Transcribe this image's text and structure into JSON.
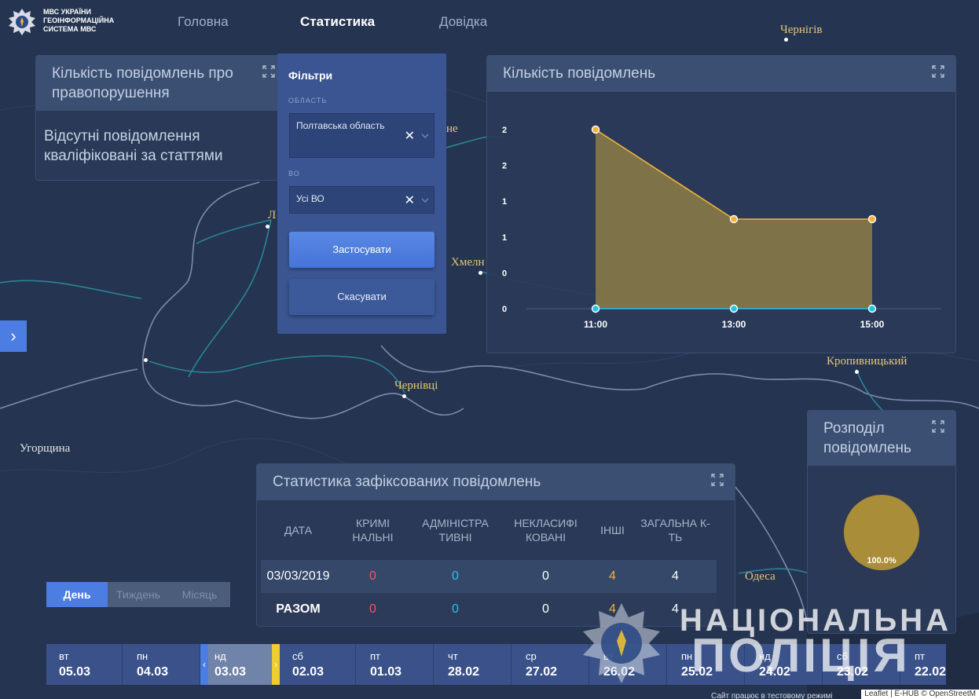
{
  "header": {
    "brand_lines": [
      "МВС УКРАЇНИ",
      "ГЕОІНФОРМАЦІЙНА",
      "СИСТЕМА МВС"
    ],
    "nav": [
      {
        "label": "Головна",
        "active": false
      },
      {
        "label": "Статистика",
        "active": true
      },
      {
        "label": "Довідка",
        "active": false
      }
    ]
  },
  "map_labels": {
    "chernihiv": "Чернігів",
    "khmelnytskyi": "Хмелн",
    "chernivtsi": "Чернівці",
    "kropyvnytskyi": "Кропивницький",
    "hungary": "Угорщина",
    "odesa": "Одеса",
    "rivne_partial": "не",
    "lutsk_partial": "Л"
  },
  "offenses_panel": {
    "title": "Кількість повідомлень про правопорушення",
    "empty_text": "Відсутні повідомлення кваліфіковані за статтями"
  },
  "filters": {
    "title": "Фільтри",
    "region_label": "ОБЛАСТЬ",
    "region_value": "Полтавська область",
    "vo_label": "ВО",
    "vo_value": "Усі ВО",
    "clear_symbol": "✕",
    "apply_label": "Застосувати",
    "cancel_label": "Скасувати"
  },
  "chart_panel": {
    "title": "Кількість повідомлень"
  },
  "chart_data": {
    "type": "area",
    "categories": [
      "11:00",
      "13:00",
      "15:00"
    ],
    "y_tick_labels": [
      "0",
      "0",
      "1",
      "1",
      "2",
      "2"
    ],
    "ylim": [
      0,
      2
    ],
    "series": [
      {
        "values": [
          2,
          1,
          1
        ],
        "color": "#f1b23b"
      },
      {
        "values": [
          0,
          0,
          0
        ],
        "color": "#27c3e6"
      }
    ],
    "grid": false
  },
  "distribution_panel": {
    "title": "Розподіл повідомлень",
    "pie": {
      "slices": [
        {
          "value": 100,
          "label": "100.0%",
          "color": "#a98d39"
        }
      ]
    }
  },
  "stats_panel": {
    "title": "Статистика зафіксованих повідомлень",
    "columns": [
      "ДАТА",
      "КРИМІ НАЛЬНІ",
      "АДМІНІСТРА ТИВНІ",
      "НЕКЛАСИФІ КОВАНІ",
      "ІНШІ",
      "ЗАГАЛЬНА К-ТЬ"
    ],
    "rows": [
      {
        "date": "03/03/2019",
        "criminal": "0",
        "admin": "0",
        "unclassified": "0",
        "other": "4",
        "total": "4"
      }
    ],
    "total_row": {
      "label": "РАЗОМ",
      "criminal": "0",
      "admin": "0",
      "unclassified": "0",
      "other": "4",
      "total": "4"
    }
  },
  "period": {
    "options": [
      {
        "label": "День",
        "active": true
      },
      {
        "label": "Тиждень",
        "active": false
      },
      {
        "label": "Місяць",
        "active": false
      }
    ]
  },
  "timeline": {
    "days": [
      {
        "dow": "вт",
        "date": "05.03"
      },
      {
        "dow": "пн",
        "date": "04.03"
      },
      {
        "dow": "нд",
        "date": "03.03",
        "selected": true
      },
      {
        "dow": "сб",
        "date": "02.03"
      },
      {
        "dow": "пт",
        "date": "01.03"
      },
      {
        "dow": "чт",
        "date": "28.02"
      },
      {
        "dow": "ср",
        "date": "27.02"
      },
      {
        "dow": "вт",
        "date": "26.02"
      },
      {
        "dow": "пн",
        "date": "25.02"
      },
      {
        "dow": "нд",
        "date": "24.02"
      },
      {
        "dow": "сб",
        "date": "23.02"
      },
      {
        "dow": "пт",
        "date": "22.02"
      }
    ],
    "handle_left": "‹",
    "handle_right": "›"
  },
  "side_toggle": "›",
  "watermark": {
    "line1": "НАЦІОНАЛЬНА",
    "line2": "ПОЛІЦІЯ"
  },
  "footer": {
    "left": "Сайт працює в тестовому режимі",
    "right": "Leaflet | E-HUB © OpenStreetM"
  },
  "colors": {
    "accent": "#4c7de2",
    "series_primary": "#f1b23b",
    "series_secondary": "#27c3e6",
    "negative": "#f05a5a"
  }
}
